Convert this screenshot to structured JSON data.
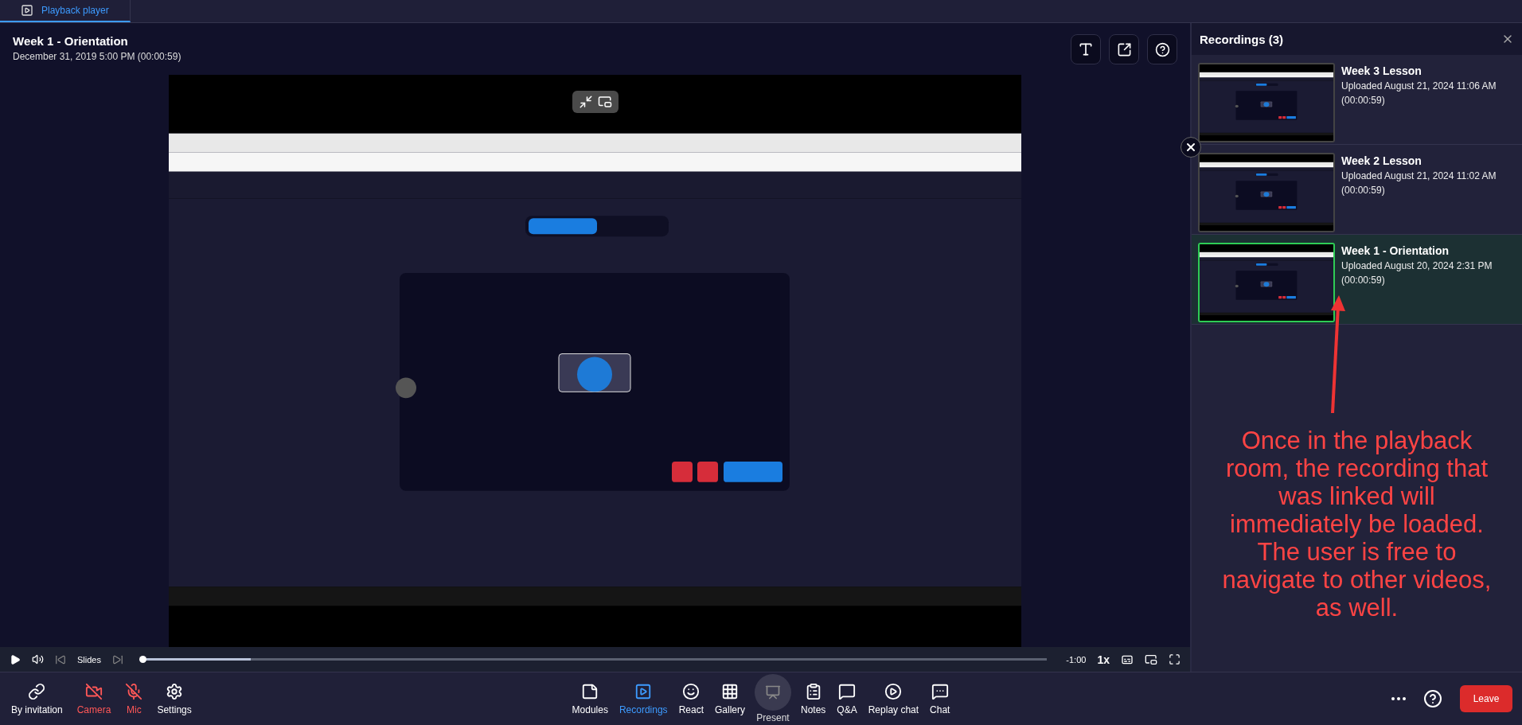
{
  "tabs": [
    {
      "label": "Playback player",
      "selected": true
    }
  ],
  "recording": {
    "title": "Week 1 - Orientation",
    "subtitle": "December 31, 2019 5:00 PM (00:00:59)"
  },
  "player": {
    "progress": {
      "level": 0.12
    },
    "slides_label": "Slides",
    "remaining": "-1:00",
    "speed": "1x"
  },
  "recordings_panel": {
    "title": "Recordings (3)",
    "items": [
      {
        "title": "Week 3 Lesson",
        "uploaded": "Uploaded August 21, 2024 11:06 AM",
        "duration": "(00:00:59)",
        "selected": false
      },
      {
        "title": "Week 2 Lesson",
        "uploaded": "Uploaded August 21, 2024 11:02 AM",
        "duration": "(00:00:59)",
        "selected": false
      },
      {
        "title": "Week 1 - Orientation",
        "uploaded": "Uploaded August 20, 2024 2:31 PM",
        "duration": "(00:00:59)",
        "selected": true
      }
    ]
  },
  "annotation": "Once in the playback room, the recording that was linked will immediately be loaded. The user is free to navigate to other videos, as well.",
  "toolbar": {
    "left": [
      {
        "label": "By invitation",
        "on": true
      },
      {
        "label": "Camera",
        "on": false
      },
      {
        "label": "Mic",
        "on": false
      },
      {
        "label": "Settings",
        "on": true
      }
    ],
    "center": [
      {
        "label": "Modules",
        "selected": false,
        "disabled": false
      },
      {
        "label": "Recordings",
        "selected": true,
        "disabled": false
      },
      {
        "label": "React",
        "selected": false,
        "disabled": false
      },
      {
        "label": "Gallery",
        "selected": false,
        "disabled": false
      },
      {
        "label": "Present",
        "selected": false,
        "disabled": true
      },
      {
        "label": "Notes",
        "selected": false,
        "disabled": false
      },
      {
        "label": "Q&A",
        "selected": false,
        "disabled": false
      },
      {
        "label": "Replay chat",
        "selected": false,
        "disabled": false
      },
      {
        "label": "Chat",
        "selected": false,
        "disabled": false
      }
    ],
    "leave": "Leave"
  }
}
